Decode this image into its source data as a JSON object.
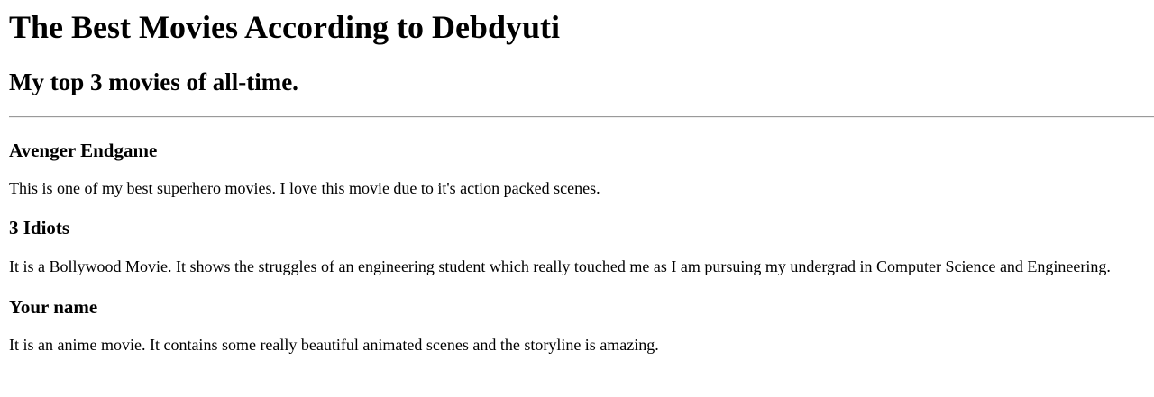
{
  "page_title": "The Best Movies According to Debdyuti",
  "subtitle": "My top 3 movies of all-time.",
  "movies": [
    {
      "title": "Avenger Endgame",
      "description": "This is one of my best superhero movies. I love this movie due to it's action packed scenes."
    },
    {
      "title": "3 Idiots",
      "description": "It is a Bollywood Movie. It shows the struggles of an engineering student which really touched me as I am pursuing my undergrad in Computer Science and Engineering."
    },
    {
      "title": "Your name",
      "description": "It is an anime movie. It contains some really beautiful animated scenes and the storyline is amazing."
    }
  ]
}
